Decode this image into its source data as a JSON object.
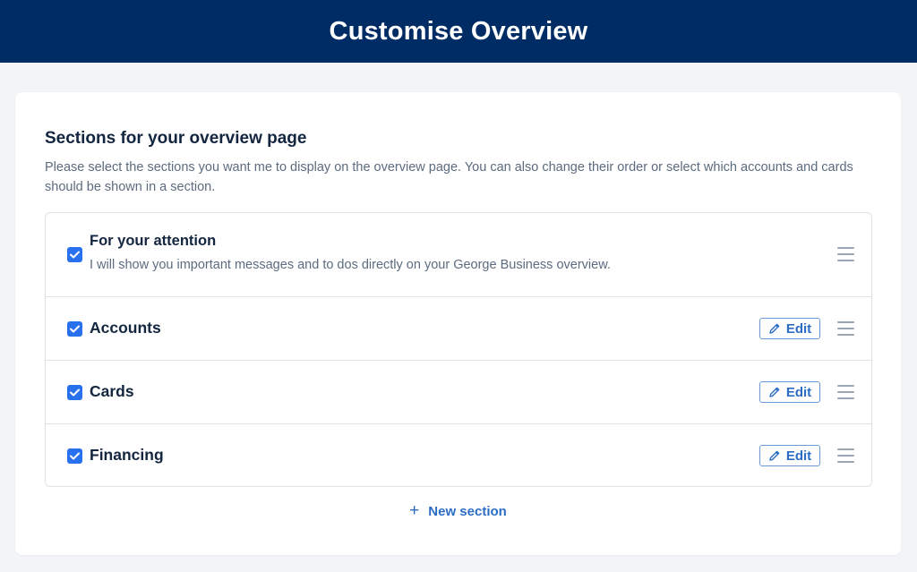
{
  "header": {
    "title": "Customise Overview"
  },
  "section": {
    "title": "Sections for your overview page",
    "description": "Please select the sections you want me to display on the overview page. You can also change their order or select which accounts and cards should be shown in a section."
  },
  "rows": [
    {
      "title": "For your attention",
      "description": "I will show you important messages and to dos directly on your George Business overview.",
      "checked": true
    },
    {
      "title": "Accounts",
      "edit_label": "Edit",
      "checked": true
    },
    {
      "title": "Cards",
      "edit_label": "Edit",
      "checked": true
    },
    {
      "title": "Financing",
      "edit_label": "Edit",
      "checked": true
    }
  ],
  "new_section": {
    "icon": "+",
    "label": "New section"
  },
  "colors": {
    "header_bg": "#002c66",
    "accent": "#2870ed",
    "link": "#2b6cc4"
  },
  "icons": {
    "checkbox": "checkmark-icon",
    "edit": "pencil-icon",
    "drag": "drag-handle-icon",
    "add": "plus-icon"
  }
}
